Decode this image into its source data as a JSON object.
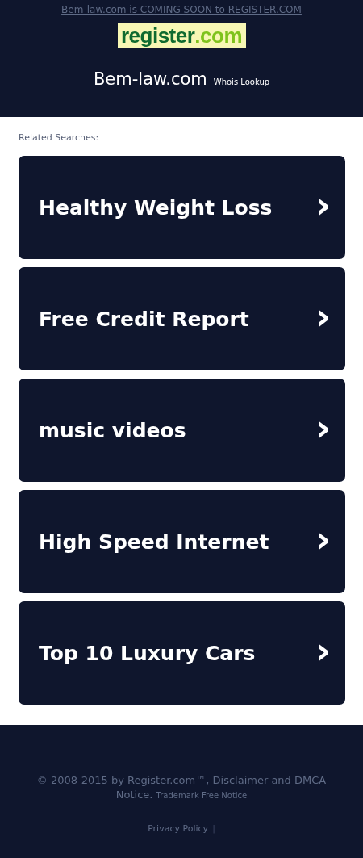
{
  "header": {
    "notice": "Bem-law.com is COMING SOON to REGISTER.COM",
    "logo": {
      "name": "register",
      "suffix": ".com"
    },
    "domain": "Bem-law.com",
    "whois_link": "Whois Lookup"
  },
  "related": {
    "title": "Related Searches:",
    "items": [
      {
        "label": "Healthy Weight Loss",
        "arrow": "›"
      },
      {
        "label": "Free Credit Report",
        "arrow": "›"
      },
      {
        "label": "music videos",
        "arrow": "›"
      },
      {
        "label": "High Speed Internet",
        "arrow": "›"
      },
      {
        "label": "Top 10 Luxury Cars",
        "arrow": "›"
      }
    ]
  },
  "footer": {
    "copyright": "© 2008-2015 by Register.com™, Disclaimer and DMCA Notice.",
    "trademark_link": "Trademark Free Notice",
    "privacy_link": "Privacy Policy",
    "separator": "|"
  }
}
